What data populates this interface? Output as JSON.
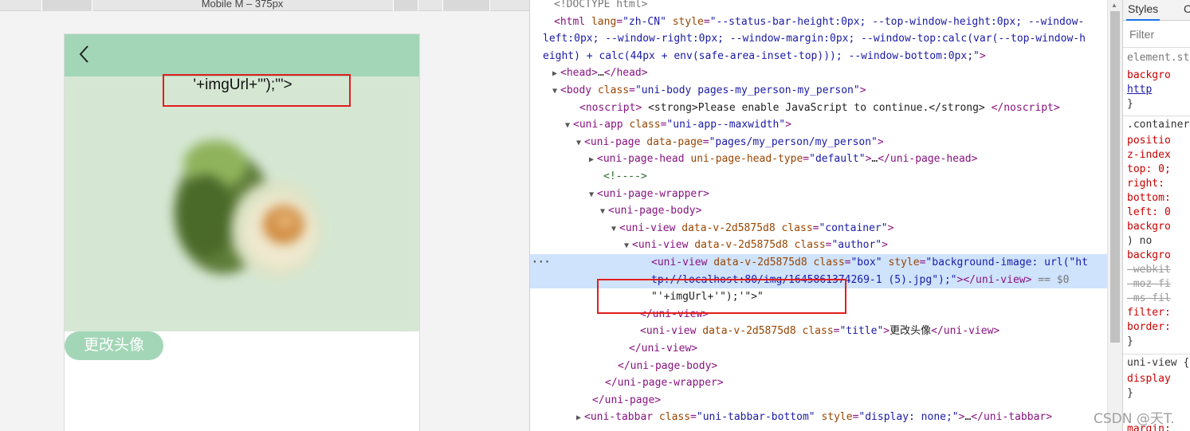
{
  "preview": {
    "device_label": "Mobile M – 375px",
    "leaked_text": "'+imgUrl+'\");'\">",
    "change_avatar_label": "更改头像"
  },
  "elements": {
    "lines": [
      {
        "tri": "",
        "parts": [
          {
            "c": "gr",
            "t": "<!DOCTYPE html>"
          }
        ]
      },
      {
        "tri": "",
        "parts": [
          {
            "c": "tag",
            "t": "<html "
          },
          {
            "c": "an",
            "t": "lang"
          },
          {
            "c": "tag",
            "t": "="
          },
          {
            "c": "av",
            "t": "\"zh-CN\""
          },
          {
            "c": "tag",
            "t": " "
          },
          {
            "c": "an",
            "t": "style"
          },
          {
            "c": "tag",
            "t": "="
          },
          {
            "c": "av",
            "t": "\"--status-bar-height:0px; --top-window-height:0px; --window-"
          }
        ]
      },
      {
        "tri": "",
        "parts": [
          {
            "c": "av",
            "t": "left:0px; --window-right:0px; --window-margin:0px; --window-top:calc(var(--top-window-h"
          }
        ]
      },
      {
        "tri": "",
        "parts": [
          {
            "c": "av",
            "t": "eight) + calc(44px + env(safe-area-inset-top))); --window-bottom:0px;\""
          },
          {
            "c": "tag",
            "t": ">"
          }
        ]
      },
      {
        "tri": "▶",
        "parts": [
          {
            "c": "tag",
            "t": "<head>"
          },
          {
            "c": "tx",
            "t": "…"
          },
          {
            "c": "tag",
            "t": "</head>"
          }
        ]
      },
      {
        "tri": "▼",
        "parts": [
          {
            "c": "tag",
            "t": "<body "
          },
          {
            "c": "an",
            "t": "class"
          },
          {
            "c": "tag",
            "t": "="
          },
          {
            "c": "av",
            "t": "\"uni-body pages-my_person-my_person\""
          },
          {
            "c": "tag",
            "t": ">"
          }
        ]
      },
      {
        "tri": "",
        "parts": [
          {
            "c": "tag",
            "t": "<noscript>"
          },
          {
            "c": "tx",
            "t": " <strong>Please enable JavaScript to continue.</strong> "
          },
          {
            "c": "tag",
            "t": "</noscript>"
          }
        ]
      },
      {
        "tri": "▼",
        "parts": [
          {
            "c": "tag",
            "t": "<uni-app "
          },
          {
            "c": "an",
            "t": "class"
          },
          {
            "c": "tag",
            "t": "="
          },
          {
            "c": "av",
            "t": "\"uni-app--maxwidth\""
          },
          {
            "c": "tag",
            "t": ">"
          }
        ]
      },
      {
        "tri": "▼",
        "parts": [
          {
            "c": "tag",
            "t": "<uni-page "
          },
          {
            "c": "an",
            "t": "data-page"
          },
          {
            "c": "tag",
            "t": "="
          },
          {
            "c": "av",
            "t": "\"pages/my_person/my_person\""
          },
          {
            "c": "tag",
            "t": ">"
          }
        ]
      },
      {
        "tri": "▶",
        "parts": [
          {
            "c": "tag",
            "t": "<uni-page-head "
          },
          {
            "c": "an",
            "t": "uni-page-head-type"
          },
          {
            "c": "tag",
            "t": "="
          },
          {
            "c": "av",
            "t": "\"default\""
          },
          {
            "c": "tag",
            "t": ">"
          },
          {
            "c": "tx",
            "t": "…"
          },
          {
            "c": "tag",
            "t": "</uni-page-head>"
          }
        ]
      },
      {
        "tri": "",
        "parts": [
          {
            "c": "cm",
            "t": "<!---->"
          }
        ]
      },
      {
        "tri": "▼",
        "parts": [
          {
            "c": "tag",
            "t": "<uni-page-wrapper>"
          }
        ]
      },
      {
        "tri": "▼",
        "parts": [
          {
            "c": "tag",
            "t": "<uni-page-body>"
          }
        ]
      },
      {
        "tri": "▼",
        "parts": [
          {
            "c": "tag",
            "t": "<uni-view "
          },
          {
            "c": "an",
            "t": "data-v-2d5875d8"
          },
          {
            "c": "tag",
            "t": " "
          },
          {
            "c": "an",
            "t": "class"
          },
          {
            "c": "tag",
            "t": "="
          },
          {
            "c": "av",
            "t": "\"container\""
          },
          {
            "c": "tag",
            "t": ">"
          }
        ]
      },
      {
        "tri": "▼",
        "parts": [
          {
            "c": "tag",
            "t": "<uni-view "
          },
          {
            "c": "an",
            "t": "data-v-2d5875d8"
          },
          {
            "c": "tag",
            "t": " "
          },
          {
            "c": "an",
            "t": "class"
          },
          {
            "c": "tag",
            "t": "="
          },
          {
            "c": "av",
            "t": "\"author\""
          },
          {
            "c": "tag",
            "t": ">"
          }
        ]
      },
      {
        "tri": "",
        "parts": [
          {
            "c": "tag",
            "t": "<uni-view "
          },
          {
            "c": "an",
            "t": "data-v-2d5875d8"
          },
          {
            "c": "tag",
            "t": " "
          },
          {
            "c": "an",
            "t": "class"
          },
          {
            "c": "tag",
            "t": "="
          },
          {
            "c": "av",
            "t": "\"box\""
          },
          {
            "c": "tag",
            "t": " "
          },
          {
            "c": "an",
            "t": "style"
          },
          {
            "c": "tag",
            "t": "="
          },
          {
            "c": "av",
            "t": "\"background-image: url(\"ht"
          }
        ]
      },
      {
        "tri": "",
        "parts": [
          {
            "c": "av",
            "t": "tp://localhost:80/img/1645861374269-1 (5).jpg\");\""
          },
          {
            "c": "tag",
            "t": "></uni-view>"
          },
          {
            "c": "gr",
            "t": " == $0"
          }
        ]
      },
      {
        "tri": "",
        "parts": [
          {
            "c": "tx",
            "t": "\"'+imgUrl+'\");'\">\""
          }
        ]
      },
      {
        "tri": "",
        "parts": [
          {
            "c": "tag",
            "t": "</uni-view>"
          }
        ]
      },
      {
        "tri": "",
        "parts": [
          {
            "c": "tag",
            "t": "<uni-view "
          },
          {
            "c": "an",
            "t": "data-v-2d5875d8"
          },
          {
            "c": "tag",
            "t": " "
          },
          {
            "c": "an",
            "t": "class"
          },
          {
            "c": "tag",
            "t": "="
          },
          {
            "c": "av",
            "t": "\"title\""
          },
          {
            "c": "tag",
            "t": ">"
          },
          {
            "c": "tx",
            "t": "更改头像"
          },
          {
            "c": "tag",
            "t": "</uni-view>"
          }
        ]
      },
      {
        "tri": "",
        "parts": [
          {
            "c": "tag",
            "t": "</uni-view>"
          }
        ]
      },
      {
        "tri": "",
        "parts": [
          {
            "c": "tag",
            "t": "</uni-page-body>"
          }
        ]
      },
      {
        "tri": "",
        "parts": [
          {
            "c": "tag",
            "t": "</uni-page-wrapper>"
          }
        ]
      },
      {
        "tri": "",
        "parts": [
          {
            "c": "tag",
            "t": "</uni-page>"
          }
        ]
      },
      {
        "tri": "▶",
        "parts": [
          {
            "c": "tag",
            "t": "<uni-tabbar "
          },
          {
            "c": "an",
            "t": "class"
          },
          {
            "c": "tag",
            "t": "="
          },
          {
            "c": "av",
            "t": "\"uni-tabbar-bottom\""
          },
          {
            "c": "tag",
            "t": " "
          },
          {
            "c": "an",
            "t": "style"
          },
          {
            "c": "tag",
            "t": "="
          },
          {
            "c": "av",
            "t": "\"display: none;\""
          },
          {
            "c": "tag",
            "t": ">"
          },
          {
            "c": "tx",
            "t": "…"
          },
          {
            "c": "tag",
            "t": "</uni-tabbar>"
          }
        ]
      }
    ],
    "selected_index": 15,
    "selected_dots": "···"
  },
  "styles": {
    "tab_styles": "Styles",
    "tab_computed": "C",
    "filter_placeholder": "Filter",
    "lines": [
      {
        "c": "gr",
        "t": "element.st"
      },
      {
        "c": "prop",
        "t": "  backgro"
      },
      {
        "c": "link",
        "t": "   http"
      },
      {
        "c": "sel-name",
        "t": "}"
      },
      {
        "c": "sel-name",
        "t": ".container"
      },
      {
        "c": "prop",
        "t": "  positio"
      },
      {
        "c": "prop",
        "t": "  z-index"
      },
      {
        "c": "prop",
        "t": "  top: 0;"
      },
      {
        "c": "prop",
        "t": "  right: "
      },
      {
        "c": "prop",
        "t": "  bottom:"
      },
      {
        "c": "prop",
        "t": "  left: 0"
      },
      {
        "c": "prop",
        "t": "  backgro"
      },
      {
        "c": "sel-name",
        "t": "    ) no"
      },
      {
        "c": "prop",
        "t": "  backgro"
      },
      {
        "c": "strike",
        "t": "  -webkit"
      },
      {
        "c": "strike",
        "t": "  -moz-fi"
      },
      {
        "c": "strike",
        "t": "  -ms-fil"
      },
      {
        "c": "prop",
        "t": "  filter:"
      },
      {
        "c": "prop",
        "t": "  border:"
      },
      {
        "c": "sel-name",
        "t": "}"
      },
      {
        "c": "sel-name",
        "t": "uni-view {"
      },
      {
        "c": "prop",
        "t": "  display"
      },
      {
        "c": "sel-name",
        "t": "}"
      }
    ],
    "last_line": "  margin:"
  },
  "watermark": "CSDN @天T."
}
